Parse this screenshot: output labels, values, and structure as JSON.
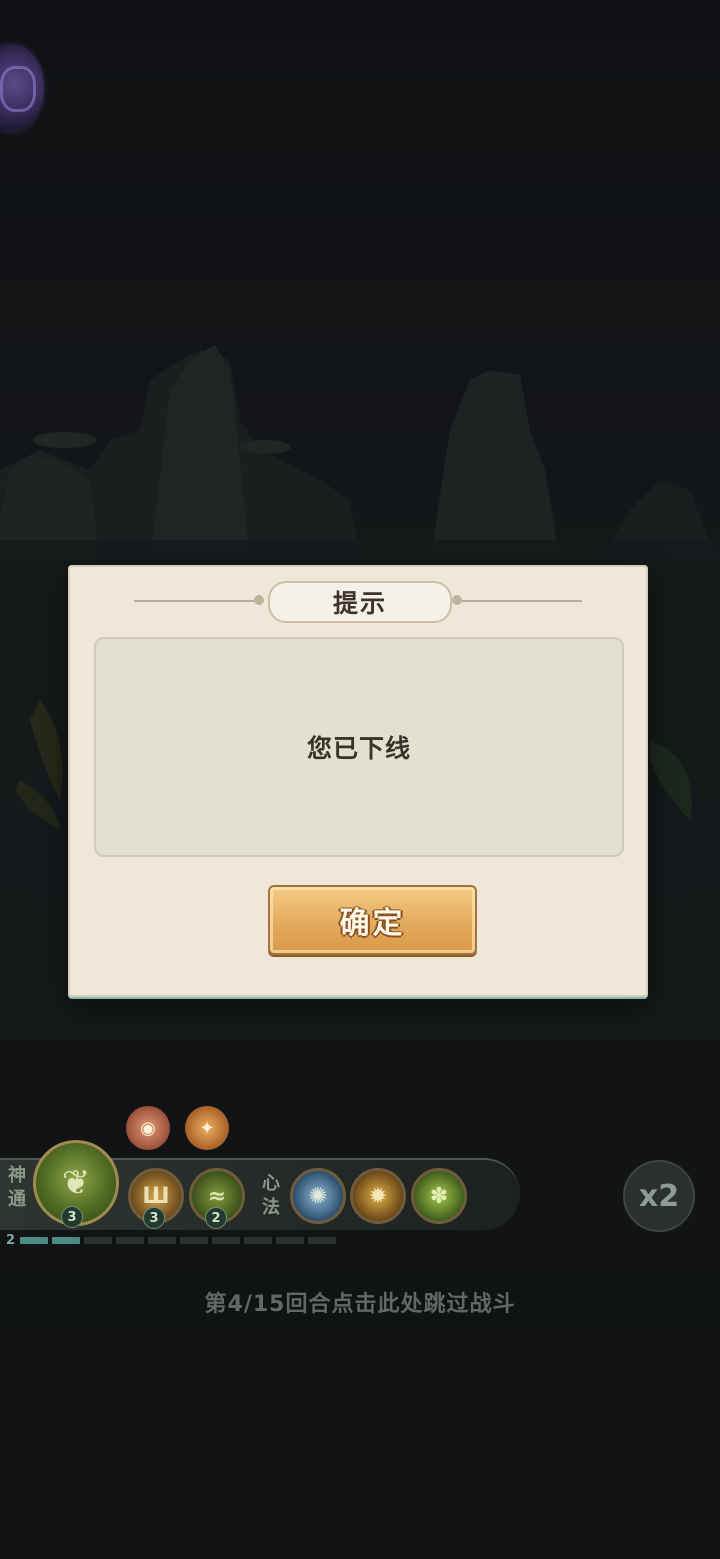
{
  "dialog": {
    "title": "提示",
    "message": "您已下线",
    "confirm_label": "确定"
  },
  "skill_bar": {
    "left_label": "神通",
    "right_label": "心法",
    "main_skill_count": "3",
    "skill_counts": [
      "3",
      "2"
    ],
    "progress_level": "2",
    "progress": {
      "filled_segments": 2,
      "total_segments": 10
    }
  },
  "speed_button": {
    "label": "x2"
  },
  "round_info": "第4/15回合点击此处跳过战斗",
  "colors": {
    "dialog_bg": "#efe8da",
    "button_gold": "#e3a85a",
    "progress_fill": "#4e8b86"
  }
}
